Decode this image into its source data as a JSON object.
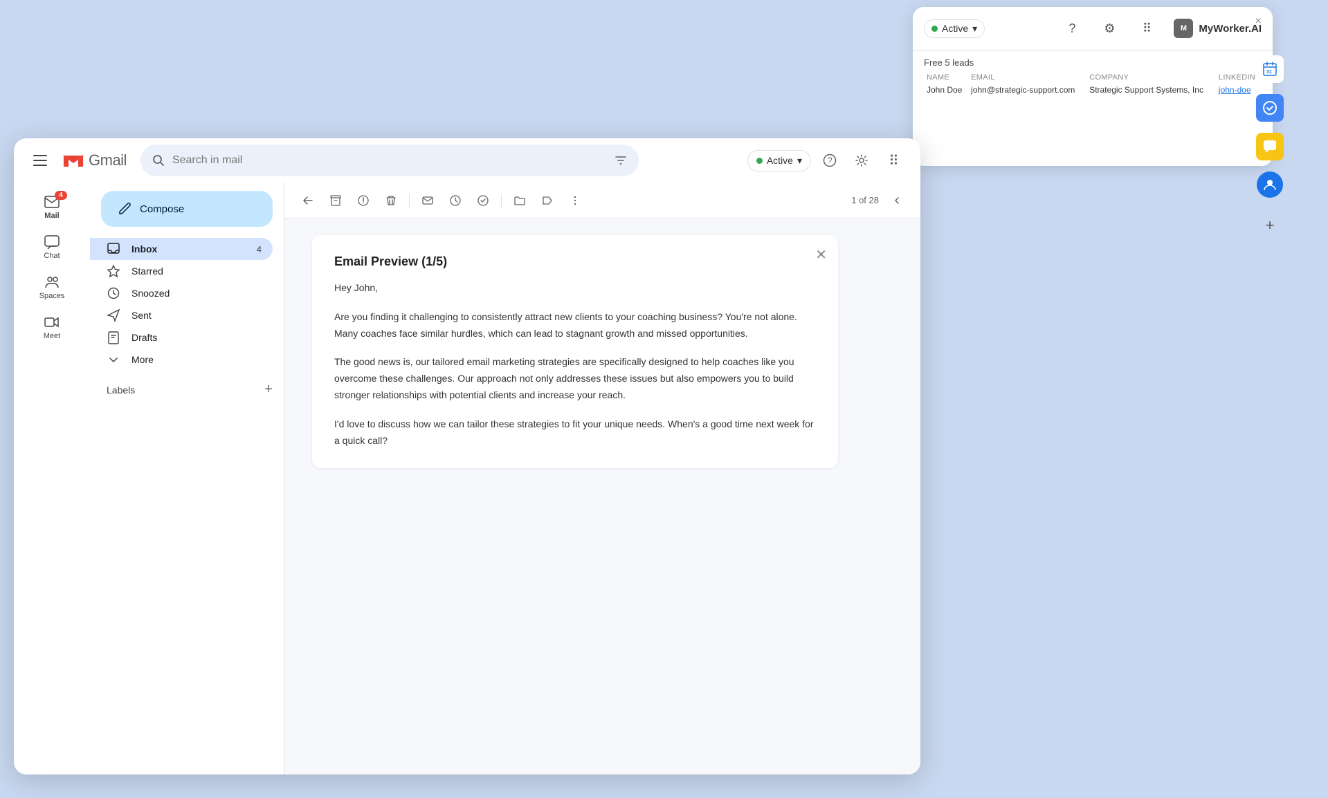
{
  "myworker": {
    "active_label": "Active",
    "active_chevron": "▾",
    "brand_name": "MyWorker.AI",
    "close_x": "×",
    "table": {
      "free_leads_label": "Free 5 leads",
      "columns": [
        "NAME",
        "EMAIL",
        "COMPANY",
        "LINKEDIN"
      ],
      "rows": [
        {
          "name": "John Doe",
          "email": "john@strategic-support.com",
          "company": "Strategic Support Systems, Inc",
          "linkedin": "john-doe",
          "linkedin_label": "john-doe"
        }
      ]
    }
  },
  "gmail": {
    "title": "Gmail",
    "search_placeholder": "Search in mail",
    "active_label": "Active",
    "active_chevron": "▾",
    "page_info": "1 of 28",
    "sidebar": {
      "mail_label": "Mail",
      "mail_badge": "4",
      "chat_label": "Chat",
      "spaces_label": "Spaces",
      "meet_label": "Meet"
    },
    "nav": {
      "compose_label": "Compose",
      "items": [
        {
          "id": "inbox",
          "label": "Inbox",
          "icon": "inbox",
          "count": "4",
          "active": true
        },
        {
          "id": "starred",
          "label": "Starred",
          "icon": "star",
          "count": "",
          "active": false
        },
        {
          "id": "snoozed",
          "label": "Snoozed",
          "icon": "clock",
          "count": "",
          "active": false
        },
        {
          "id": "sent",
          "label": "Sent",
          "icon": "sent",
          "count": "",
          "active": false
        },
        {
          "id": "drafts",
          "label": "Drafts",
          "icon": "draft",
          "count": "",
          "active": false
        },
        {
          "id": "more",
          "label": "More",
          "icon": "chevron",
          "count": "",
          "active": false
        }
      ],
      "labels_header": "Labels",
      "labels_add": "+"
    },
    "email": {
      "title": "Email Preview (1/5)",
      "greeting": "Hey John,",
      "paragraph1": "Are you finding it challenging to consistently attract new clients to your coaching business? You're not alone. Many coaches face similar hurdles, which can lead to stagnant growth and missed opportunities.",
      "paragraph2": "The good news is, our tailored email marketing strategies are specifically designed to help coaches like you overcome these challenges. Our approach not only addresses these issues but also empowers you to build stronger relationships with potential clients and increase your reach.",
      "paragraph3": "I'd love to discuss how we can tailor these strategies to fit your unique needs. When's a good time next week for a quick call?"
    }
  },
  "right_sidebar": {
    "add_label": "+"
  }
}
